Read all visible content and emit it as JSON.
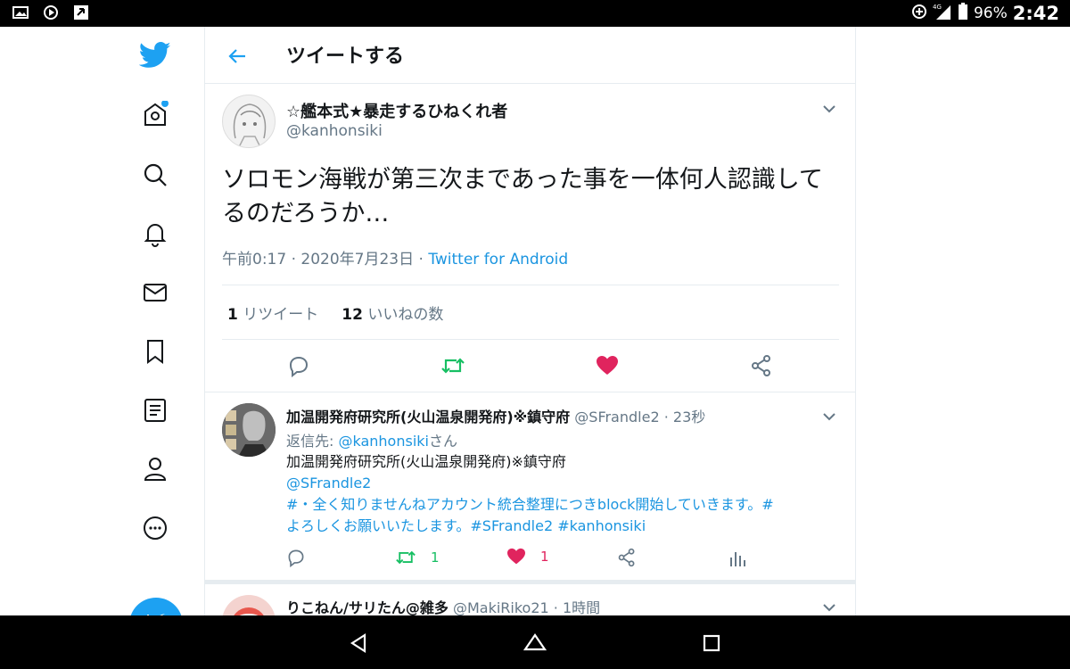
{
  "status_bar": {
    "battery_percent": "96%",
    "time": "2:42",
    "network": "4G"
  },
  "nav": {
    "items": [
      "home",
      "explore",
      "notifications",
      "messages",
      "bookmarks",
      "lists",
      "profile",
      "more"
    ],
    "compose_label": "+"
  },
  "header": {
    "title": "ツイートする"
  },
  "tweet": {
    "display_name": "☆艦本式★暴走するひねくれ者",
    "handle": "@kanhonsiki",
    "text": "ソロモン海戦が第三次まであった事を一体何人認識してるのだろうか…",
    "timestamp": "午前0:17 · 2020年7月23日 · ",
    "source": "Twitter for Android",
    "retweet_count": "1",
    "retweet_label": " リツイート",
    "like_count": "12",
    "like_label": " いいねの数"
  },
  "reply": {
    "display_name": "加温開発府研究所(火山温泉開発府)※鎮守府",
    "handle_time": "@SFrandle2 · 23秒",
    "reply_to_prefix": "返信先: ",
    "reply_to_handle": "@kanhonsiki",
    "reply_to_suffix": "さん",
    "body_line1": "加温開発府研究所(火山温泉開発府)※鎮守府",
    "body_line2": "@SFrandle2",
    "body_line3": "#・全く知りませんねアカウント統合整理につきblock開始していきます。#",
    "body_line4": "よろしくお願いいたします。#SFrandle2 #kanhonsiki",
    "retweet_count": "1",
    "like_count": "1"
  },
  "reply2": {
    "display_name": "りこねん/サリたん@雑多",
    "handle_time": "@MakiRiko21 · 1時間"
  },
  "colors": {
    "twitter_blue": "#1da1f2",
    "retweet_green": "#17bf63",
    "like_red": "#e0245e",
    "secondary_text": "#657786"
  }
}
